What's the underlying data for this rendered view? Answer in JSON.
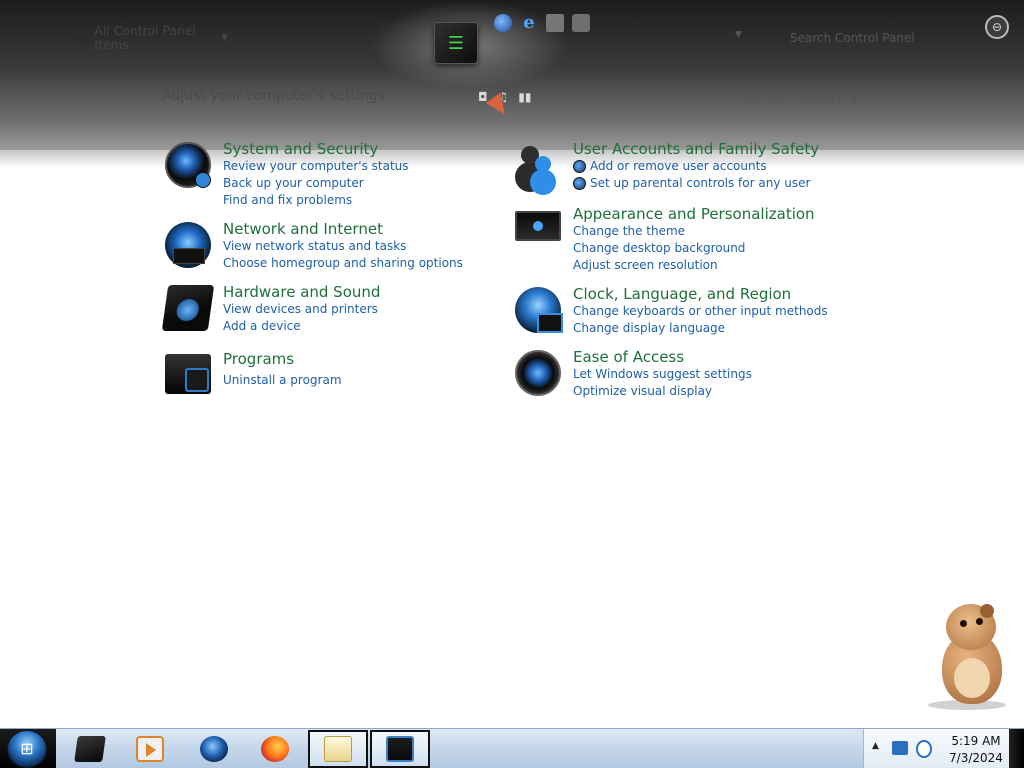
{
  "window": {
    "address_path": "All Control Panel Items",
    "search_placeholder": "Search Control Panel",
    "page_title": "Adjust your computer's settings",
    "view_by_label": "View by:",
    "view_by_value": "Category",
    "center_logo_text": "☰"
  },
  "categories_left": [
    {
      "title": "System and Security",
      "icon": "security-shield-icon",
      "links": [
        "Review your computer's status",
        "Back up your computer",
        "Find and fix problems"
      ]
    },
    {
      "title": "Network and Internet",
      "icon": "network-globe-icon",
      "links": [
        "View network status and tasks",
        "Choose homegroup and sharing options"
      ]
    },
    {
      "title": "Hardware and Sound",
      "icon": "hardware-printer-icon",
      "links": [
        "View devices and printers",
        "Add a device"
      ]
    },
    {
      "title": "Programs",
      "icon": "programs-icon",
      "links": [
        "Uninstall a program"
      ]
    }
  ],
  "categories_right": [
    {
      "title": "User Accounts and Family Safety",
      "icon": "users-icon",
      "links": [
        "Add or remove user accounts",
        "Set up parental controls for any user"
      ]
    },
    {
      "title": "Appearance and Personalization",
      "icon": "monitor-icon",
      "links": [
        "Change the theme",
        "Change desktop background",
        "Adjust screen resolution"
      ]
    },
    {
      "title": "Clock, Language, and Region",
      "icon": "clock-globe-icon",
      "links": [
        "Change keyboards or other input methods",
        "Change display language"
      ]
    },
    {
      "title": "Ease of Access",
      "icon": "ease-of-access-icon",
      "links": [
        "Let Windows suggest settings",
        "Optimize visual display"
      ]
    }
  ],
  "taskbar": {
    "start_glyph": "⊞",
    "pinned": [
      "explorer-icon",
      "media-player-icon",
      "globe-icon",
      "firefox-icon",
      "control-panel-icon",
      "monitor-icon"
    ],
    "clock_time": "5:19 AM",
    "clock_date": "7/3/2024"
  },
  "colors": {
    "category_title": "#1f6f3a",
    "link": "#1e5fa8",
    "taskbar": "#c4d6ea"
  }
}
